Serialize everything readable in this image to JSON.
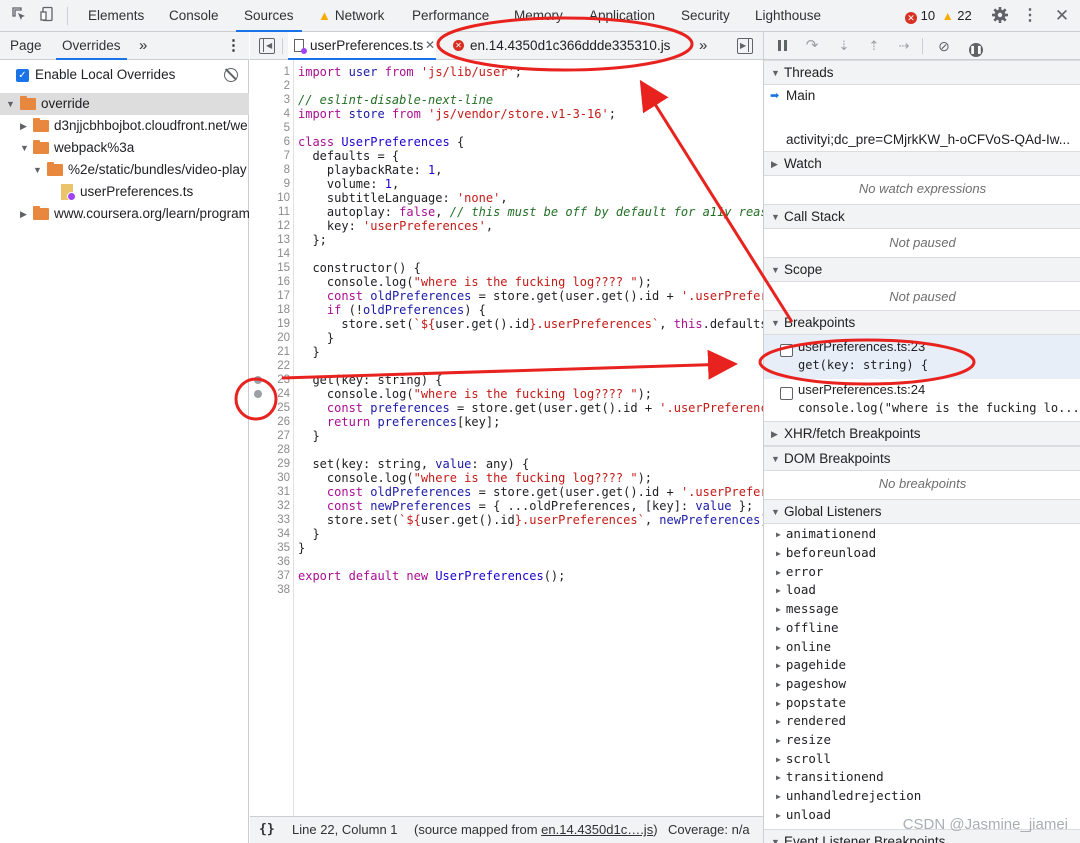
{
  "topbar": {
    "tabs": [
      "Elements",
      "Console",
      "Sources",
      "Network",
      "Performance",
      "Memory",
      "Application",
      "Security",
      "Lighthouse"
    ],
    "active_tab": "Sources",
    "error_count": "10",
    "warning_count": "22",
    "icons": [
      "inspect-icon",
      "device-toolbar-icon",
      "error-icon",
      "warning-icon",
      "settings-icon",
      "more-icon",
      "close-icon"
    ]
  },
  "navigator": {
    "tabs": [
      "Page",
      "Overrides"
    ],
    "active_tab": "Overrides",
    "more": "»",
    "enable_label": "Enable Local Overrides",
    "tree": [
      {
        "label": "override",
        "depth": 0,
        "expanded": true
      },
      {
        "label": "d3njjcbhbojbot.cloudfront.net/we",
        "depth": 1,
        "expanded": false
      },
      {
        "label": "webpack%3a",
        "depth": 1,
        "expanded": true
      },
      {
        "label": "%2e/static/bundles/video-play",
        "depth": 2,
        "expanded": true
      },
      {
        "label": "userPreferences.ts",
        "depth": 3,
        "file": true
      },
      {
        "label": "www.coursera.org/learn/program",
        "depth": 1,
        "expanded": false
      }
    ]
  },
  "editor": {
    "tabs": [
      {
        "label": "userPreferences.ts",
        "active": true
      },
      {
        "label": "en.14.4350d1c366ddde335310.js",
        "error": true
      }
    ],
    "more": "»",
    "status": {
      "position": "Line 22, Column 1",
      "source_prefix": "(source mapped from ",
      "source_link": "en.14.4350d1c….js",
      "source_suffix": ")",
      "coverage": "Coverage: n/a"
    }
  },
  "debugger": {
    "sections": {
      "threads": "Threads",
      "watch": "Watch",
      "call_stack": "Call Stack",
      "scope": "Scope",
      "breakpoints": "Breakpoints",
      "xhr": "XHR/fetch Breakpoints",
      "dom": "DOM Breakpoints",
      "global": "Global Listeners",
      "event": "Event Listener Breakpoints"
    },
    "threads": {
      "main": "Main",
      "other": "activityi;dc_pre=CMjrkKW_h-oCFVoS-QAd-Iw..."
    },
    "no_watch": "No watch expressions",
    "not_paused_1": "Not paused",
    "not_paused_2": "Not paused",
    "no_breakpoints": "No breakpoints",
    "breakpoints": [
      {
        "location": "userPreferences.ts:23",
        "code": "get(key: string) {"
      },
      {
        "location": "userPreferences.ts:24",
        "code": "console.log(\"where is the fucking lo..."
      }
    ],
    "global_listeners": [
      "animationend",
      "beforeunload",
      "error",
      "load",
      "message",
      "offline",
      "online",
      "pagehide",
      "pageshow",
      "popstate",
      "rendered",
      "resize",
      "scroll",
      "transitionend",
      "unhandledrejection",
      "unload"
    ]
  },
  "watermark": "CSDN @Jasmine_jiamei",
  "colors": {
    "annotation": "#e8231f",
    "accent": "#1a73e8",
    "folder": "#e8883f"
  }
}
